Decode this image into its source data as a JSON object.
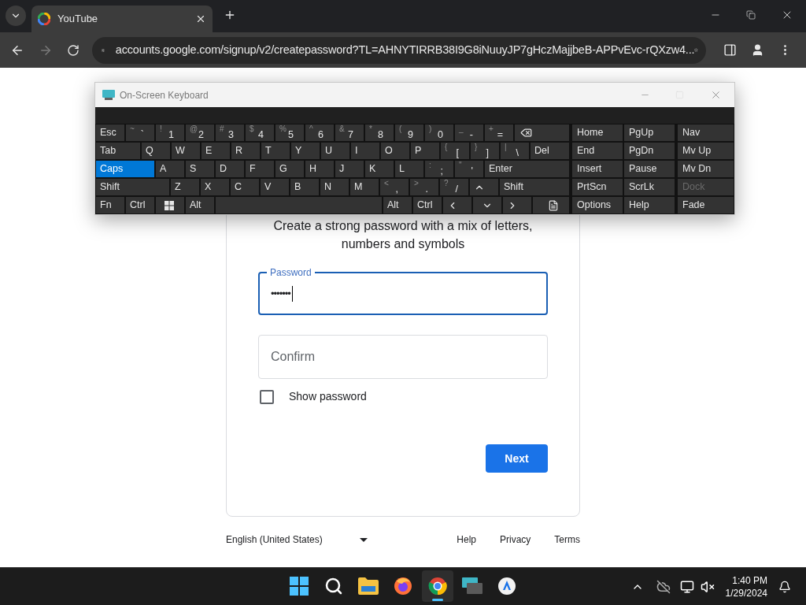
{
  "browser": {
    "tab": {
      "title": "YouTube"
    },
    "url": "accounts.google.com/signup/v2/createpassword?TL=AHNYTIRRB38I9G8iNuuyJP7gHczMajjbeB-APPvEvc-rQXzw4..."
  },
  "page": {
    "subtitle": "Create a strong password with a mix of letters, numbers and symbols",
    "password": {
      "label": "Password",
      "value": "•••••••",
      "focused": true
    },
    "confirm": {
      "placeholder": "Confirm",
      "focused": false
    },
    "show_password": {
      "label": "Show password",
      "checked": false
    },
    "next_button": "Next",
    "footer": {
      "language": "English (United States)",
      "links": [
        "Help",
        "Privacy",
        "Terms"
      ]
    }
  },
  "keyboard": {
    "title": "On-Screen Keyboard",
    "rows": [
      [
        {
          "kind": "label",
          "label": "Esc"
        },
        {
          "kind": "char",
          "shift": "~",
          "label": "`"
        },
        {
          "kind": "char",
          "shift": "!",
          "label": "1"
        },
        {
          "kind": "char",
          "shift": "@",
          "label": "2"
        },
        {
          "kind": "char",
          "shift": "#",
          "label": "3"
        },
        {
          "kind": "char",
          "shift": "$",
          "label": "4"
        },
        {
          "kind": "char",
          "shift": "%",
          "label": "5"
        },
        {
          "kind": "char",
          "shift": "^",
          "label": "6"
        },
        {
          "kind": "char",
          "shift": "&",
          "label": "7"
        },
        {
          "kind": "char",
          "shift": "*",
          "label": "8"
        },
        {
          "kind": "char",
          "shift": "(",
          "label": "9"
        },
        {
          "kind": "char",
          "shift": ")",
          "label": "0"
        },
        {
          "kind": "char",
          "shift": "_",
          "label": "-"
        },
        {
          "kind": "char",
          "shift": "+",
          "label": "="
        },
        {
          "kind": "backspace"
        }
      ],
      [
        {
          "kind": "label",
          "label": "Tab"
        },
        {
          "kind": "label",
          "label": "Q"
        },
        {
          "kind": "label",
          "label": "W"
        },
        {
          "kind": "label",
          "label": "E"
        },
        {
          "kind": "label",
          "label": "R"
        },
        {
          "kind": "label",
          "label": "T"
        },
        {
          "kind": "label",
          "label": "Y"
        },
        {
          "kind": "label",
          "label": "U"
        },
        {
          "kind": "label",
          "label": "I"
        },
        {
          "kind": "label",
          "label": "O"
        },
        {
          "kind": "label",
          "label": "P"
        },
        {
          "kind": "char",
          "shift": "{",
          "label": "["
        },
        {
          "kind": "char",
          "shift": "}",
          "label": "]"
        },
        {
          "kind": "char",
          "shift": "|",
          "label": "\\"
        },
        {
          "kind": "label",
          "label": "Del"
        }
      ],
      [
        {
          "kind": "toggle",
          "label": "Caps",
          "on": true
        },
        {
          "kind": "label",
          "label": "A"
        },
        {
          "kind": "label",
          "label": "S"
        },
        {
          "kind": "label",
          "label": "D"
        },
        {
          "kind": "label",
          "label": "F"
        },
        {
          "kind": "label",
          "label": "G"
        },
        {
          "kind": "label",
          "label": "H"
        },
        {
          "kind": "label",
          "label": "J"
        },
        {
          "kind": "label",
          "label": "K"
        },
        {
          "kind": "label",
          "label": "L"
        },
        {
          "kind": "char",
          "shift": ":",
          "label": ";"
        },
        {
          "kind": "char",
          "shift": "\"",
          "label": "'"
        },
        {
          "kind": "label",
          "label": "Enter"
        }
      ],
      [
        {
          "kind": "toggle",
          "label": "Shift",
          "on": false
        },
        {
          "kind": "label",
          "label": "Z"
        },
        {
          "kind": "label",
          "label": "X"
        },
        {
          "kind": "label",
          "label": "C"
        },
        {
          "kind": "label",
          "label": "V"
        },
        {
          "kind": "label",
          "label": "B"
        },
        {
          "kind": "label",
          "label": "N"
        },
        {
          "kind": "label",
          "label": "M"
        },
        {
          "kind": "char",
          "shift": "<",
          "label": ","
        },
        {
          "kind": "char",
          "shift": ">",
          "label": "."
        },
        {
          "kind": "char",
          "shift": "?",
          "label": "/"
        },
        {
          "kind": "up"
        },
        {
          "kind": "toggle",
          "label": "Shift",
          "on": false
        }
      ],
      [
        {
          "kind": "label",
          "label": "Fn"
        },
        {
          "kind": "toggle",
          "label": "Ctrl",
          "on": false
        },
        {
          "kind": "windows"
        },
        {
          "kind": "toggle",
          "label": "Alt",
          "on": false
        },
        {
          "kind": "space"
        },
        {
          "kind": "toggle",
          "label": "Alt",
          "on": false
        },
        {
          "kind": "toggle",
          "label": "Ctrl",
          "on": false
        },
        {
          "kind": "left"
        },
        {
          "kind": "down"
        },
        {
          "kind": "right"
        },
        {
          "kind": "menu"
        }
      ]
    ],
    "extra": [
      [
        {
          "label": "Home",
          "disabled": false
        },
        {
          "label": "PgUp",
          "disabled": false
        },
        {
          "label": "Nav",
          "disabled": false
        }
      ],
      [
        {
          "label": "End",
          "disabled": false
        },
        {
          "label": "PgDn",
          "disabled": false
        },
        {
          "label": "Mv Up",
          "disabled": false
        }
      ],
      [
        {
          "label": "Insert",
          "disabled": false
        },
        {
          "label": "Pause",
          "disabled": false
        },
        {
          "label": "Mv Dn",
          "disabled": false
        }
      ],
      [
        {
          "label": "PrtScn",
          "disabled": false
        },
        {
          "label": "ScrLk",
          "disabled": false
        },
        {
          "label": "Dock",
          "disabled": true
        }
      ],
      [
        {
          "label": "Options",
          "disabled": false
        },
        {
          "label": "Help",
          "disabled": false
        },
        {
          "label": "Fade",
          "disabled": false
        }
      ]
    ]
  },
  "taskbar": {
    "apps": [
      {
        "kind": "start",
        "active": false
      },
      {
        "kind": "search",
        "active": false
      },
      {
        "kind": "files",
        "active": false
      },
      {
        "kind": "firefox",
        "active": false
      },
      {
        "kind": "chrome",
        "active": true
      },
      {
        "kind": "keyboard",
        "active": false
      },
      {
        "kind": "app",
        "active": false
      }
    ],
    "time": "1:40 PM",
    "date": "1/29/2024"
  }
}
